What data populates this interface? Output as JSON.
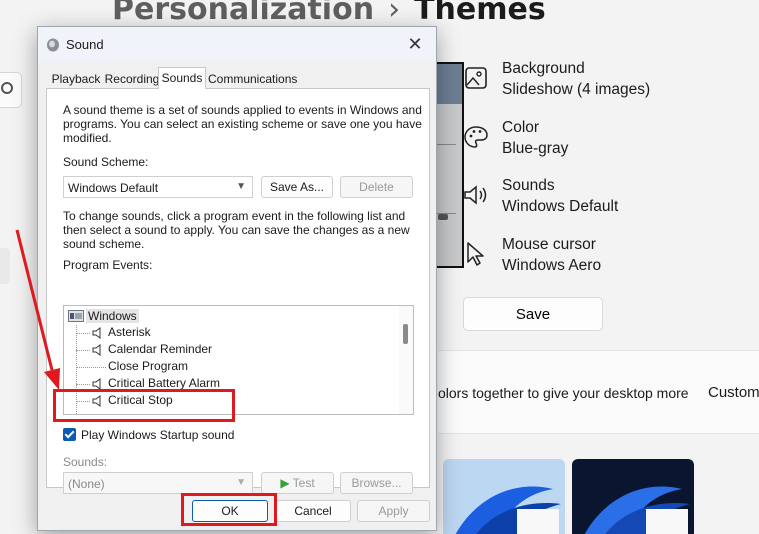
{
  "background": {
    "breadcrumb": {
      "parent": "Personalization",
      "separator": "›",
      "current": "Themes"
    },
    "settings": [
      {
        "title": "Background",
        "value": "Slideshow (4 images)",
        "icon": "image-icon"
      },
      {
        "title": "Color",
        "value": "Blue-gray",
        "icon": "palette-icon"
      },
      {
        "title": "Sounds",
        "value": "Windows Default",
        "icon": "speaker-icon"
      },
      {
        "title": "Mouse cursor",
        "value": "Windows Aero",
        "icon": "cursor-icon"
      }
    ],
    "save_label": "Save",
    "theme_description": "olors together to give your desktop more",
    "custom_label": "Custom"
  },
  "dialog": {
    "title": "Sound",
    "tabs": [
      {
        "label": "Playback"
      },
      {
        "label": "Recording"
      },
      {
        "label": "Sounds",
        "active": true
      },
      {
        "label": "Communications"
      }
    ],
    "intro_text": "A sound theme is a set of sounds applied to events in Windows and programs.  You can select an existing scheme or save one you have modified.",
    "scheme_label": "Sound Scheme:",
    "scheme_value": "Windows Default",
    "save_as_label": "Save As...",
    "delete_label": "Delete",
    "instructions_text": "To change sounds, click a program event in the following list and then select a sound to apply.  You can save the changes as a new sound scheme.",
    "events_label": "Program Events:",
    "events_root": "Windows",
    "events": [
      {
        "label": "Asterisk",
        "has_sound": true
      },
      {
        "label": "Calendar Reminder",
        "has_sound": true
      },
      {
        "label": "Close Program",
        "has_sound": false
      },
      {
        "label": "Critical Battery Alarm",
        "has_sound": true
      },
      {
        "label": "Critical Stop",
        "has_sound": true
      }
    ],
    "startup_checkbox_label": "Play Windows Startup sound",
    "startup_checked": true,
    "sounds_label": "Sounds:",
    "sounds_value": "(None)",
    "test_label": "Test",
    "browse_label": "Browse...",
    "ok_label": "OK",
    "cancel_label": "Cancel",
    "apply_label": "Apply"
  },
  "colors": {
    "annotation_red": "#e0191f",
    "checkbox_blue": "#0d5ab3",
    "wallpaper_blue": "#1b5fe0"
  }
}
